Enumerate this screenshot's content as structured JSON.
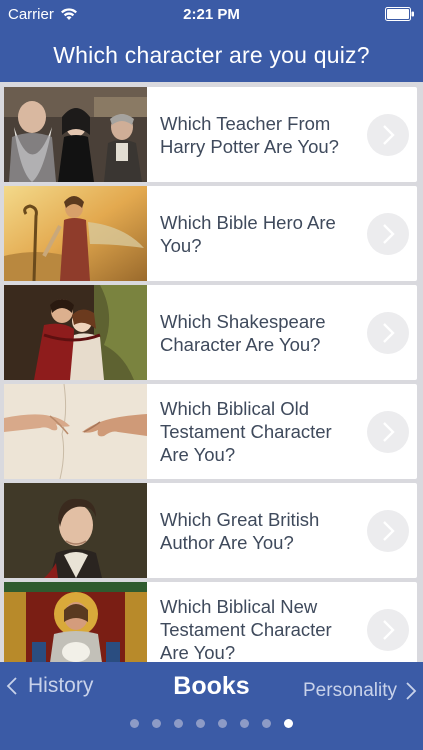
{
  "status": {
    "carrier": "Carrier",
    "time": "2:21 PM"
  },
  "header": {
    "title": "Which character are you quiz?"
  },
  "quizzes": [
    {
      "title": "Which Teacher From Harry Potter Are You?",
      "image": "teachers-photo"
    },
    {
      "title": "Which Bible Hero Are You?",
      "image": "bible-hero-painting"
    },
    {
      "title": "Which Shakespeare Character Are You?",
      "image": "romeo-juliet-painting"
    },
    {
      "title": "Which Biblical Old Testament Character Are You?",
      "image": "creation-of-adam-hands"
    },
    {
      "title": "Which Great British Author Are You?",
      "image": "lord-byron-portrait"
    },
    {
      "title": "Which Biblical New Testament Character Are You?",
      "image": "stained-glass-shepherd"
    }
  ],
  "footer": {
    "prev": "History",
    "current": "Books",
    "next": "Personality",
    "page_count": 8,
    "active_page": 8
  },
  "colors": {
    "brand": "#3b5ba6",
    "background": "#d9d9de",
    "card_text": "#3f4a5c"
  }
}
